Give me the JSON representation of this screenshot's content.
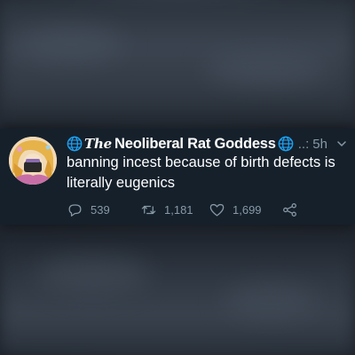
{
  "tweet": {
    "display_name": "Neoliberal Rat Goddess",
    "display_prefix": "The",
    "handle_truncated": "..:",
    "time": "5h",
    "text": "banning incest because of birth defects is literally eugenics",
    "replies": "539",
    "retweets": "1,181",
    "likes": "1,699"
  },
  "icons": {
    "globe_left": "globe-icon",
    "globe_right": "globe-icon",
    "menu": "chevron-down-icon",
    "reply": "reply-icon",
    "retweet": "retweet-icon",
    "like": "heart-icon",
    "share": "share-icon"
  },
  "colors": {
    "tweet_background": "#15202b",
    "text_primary": "#ffffff",
    "text_secondary": "#8899a6",
    "globe_blue": "#1da1f2"
  }
}
